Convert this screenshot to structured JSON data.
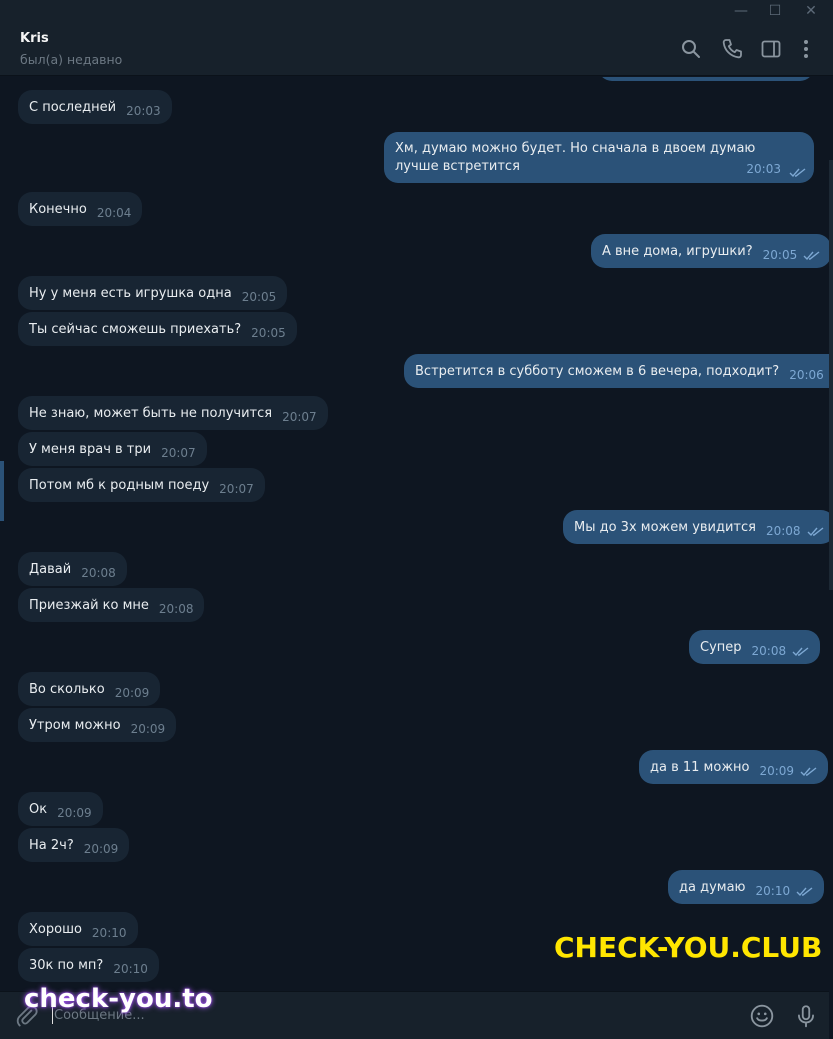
{
  "window_controls": {
    "minimize": "—",
    "maximize": "☐",
    "close": "✕"
  },
  "header": {
    "title": "Kris",
    "subtitle": "был(а) недавно"
  },
  "icons": [
    "search-icon",
    "phone-icon",
    "sidebar-toggle-icon",
    "more-icon",
    "attach-icon",
    "emoji-icon",
    "microphone-icon"
  ],
  "messages": [
    {
      "dir": "in",
      "text": "С последней",
      "time": "20:03"
    },
    {
      "dir": "out",
      "text": "Хм, думаю можно будет. Но сначала в двоем думаю лучше встретится",
      "time": "20:03"
    },
    {
      "dir": "in",
      "text": "Конечно",
      "time": "20:04"
    },
    {
      "dir": "out",
      "text": "А вне дома, игрушки?",
      "time": "20:05"
    },
    {
      "dir": "in",
      "text": "Ну у меня есть игрушка одна",
      "time": "20:05"
    },
    {
      "dir": "in",
      "text": "Ты сейчас сможешь приехать?",
      "time": "20:05"
    },
    {
      "dir": "out",
      "text": "Встретится в субботу сможем в 6 вечера, подходит?",
      "time": "20:06"
    },
    {
      "dir": "in",
      "text": "Не знаю, может быть не получится",
      "time": "20:07"
    },
    {
      "dir": "in",
      "text": "У меня врач в три",
      "time": "20:07"
    },
    {
      "dir": "in",
      "text": "Потом мб к родным поеду",
      "time": "20:07"
    },
    {
      "dir": "out",
      "text": "Мы до 3х можем увидится",
      "time": "20:08"
    },
    {
      "dir": "in",
      "text": "Давай",
      "time": "20:08"
    },
    {
      "dir": "in",
      "text": "Приезжай ко мне",
      "time": "20:08"
    },
    {
      "dir": "out",
      "text": "Супер",
      "time": "20:08"
    },
    {
      "dir": "in",
      "text": "Во сколько",
      "time": "20:09"
    },
    {
      "dir": "in",
      "text": "Утром можно",
      "time": "20:09"
    },
    {
      "dir": "out",
      "text": "да в 11 можно",
      "time": "20:09"
    },
    {
      "dir": "in",
      "text": "Ок",
      "time": "20:09"
    },
    {
      "dir": "in",
      "text": "На 2ч?",
      "time": "20:09"
    },
    {
      "dir": "out",
      "text": "да думаю",
      "time": "20:10"
    },
    {
      "dir": "in",
      "text": "Хорошо",
      "time": "20:10"
    },
    {
      "dir": "in",
      "text": "30к по мп?",
      "time": "20:10"
    }
  ],
  "watermarks": {
    "yellow": "CHECK-YOU.CLUB",
    "white": "check-you.to"
  },
  "composer": {
    "placeholder": "Сообщение..."
  },
  "colors": {
    "background": "#0e1621",
    "header": "#17212b",
    "incoming": "#182533",
    "outgoing": "#2b5278",
    "watermark_yellow": "#ffe600"
  }
}
